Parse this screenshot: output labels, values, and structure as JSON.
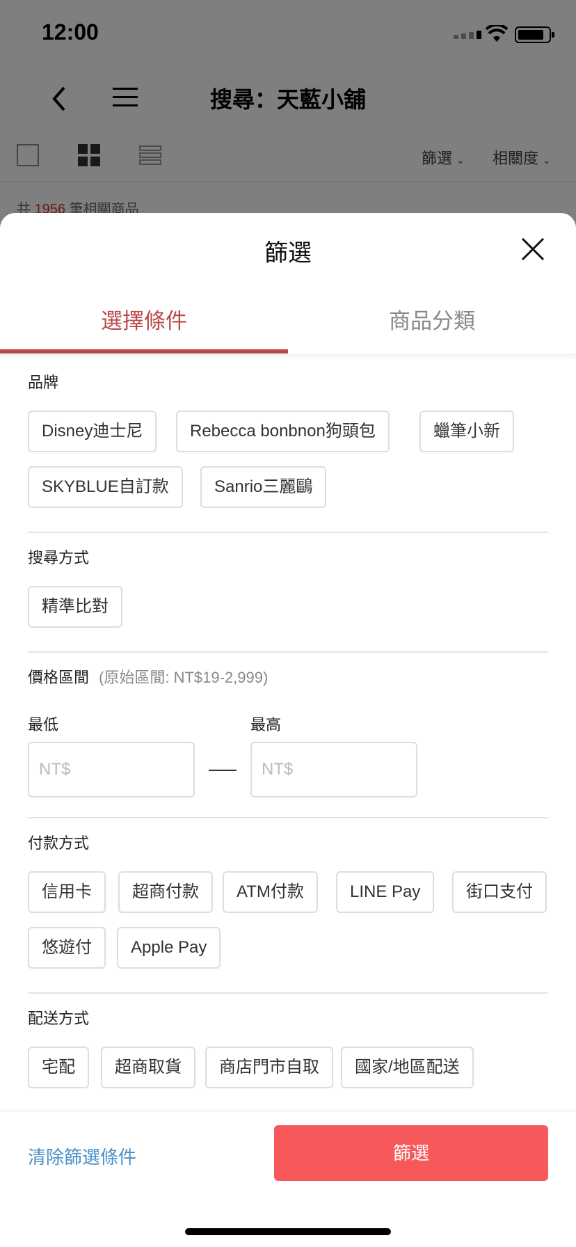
{
  "status_bar": {
    "time": "12:00"
  },
  "nav": {
    "title": "搜尋：天藍小舖"
  },
  "toolbar": {
    "filter_label": "篩選",
    "sort_label": "相關度"
  },
  "result_count": {
    "prefix": "共",
    "count": "1956",
    "suffix": "筆相關商品"
  },
  "sheet": {
    "title": "篩選",
    "tabs": [
      {
        "label": "選擇條件",
        "active": true
      },
      {
        "label": "商品分類",
        "active": false
      }
    ]
  },
  "brand": {
    "title": "品牌",
    "chips": [
      "Disney迪士尼",
      "Rebecca bonbnon狗頭包",
      "蠟筆小新",
      "SKYBLUE自訂款",
      "Sanrio三麗鷗"
    ]
  },
  "search_method": {
    "title": "搜尋方式",
    "chips": [
      "精準比對"
    ]
  },
  "price_range": {
    "title": "價格區間",
    "note": "(原始區間: NT$19-2,999)",
    "min_label": "最低",
    "max_label": "最高",
    "min_placeholder": "NT$",
    "max_placeholder": "NT$"
  },
  "payment": {
    "title": "付款方式",
    "chips": [
      "信用卡",
      "超商付款",
      "ATM付款",
      "LINE Pay",
      "街口支付",
      "悠遊付",
      "Apple Pay"
    ]
  },
  "shipping": {
    "title": "配送方式",
    "chips": [
      "宅配",
      "超商取貨",
      "商店門市自取",
      "國家/地區配送"
    ]
  },
  "footer": {
    "clear_label": "清除篩選條件",
    "apply_label": "篩選"
  },
  "colors": {
    "accent": "#b94a48",
    "apply_button": "#f7585a",
    "link": "#4a90c8"
  }
}
